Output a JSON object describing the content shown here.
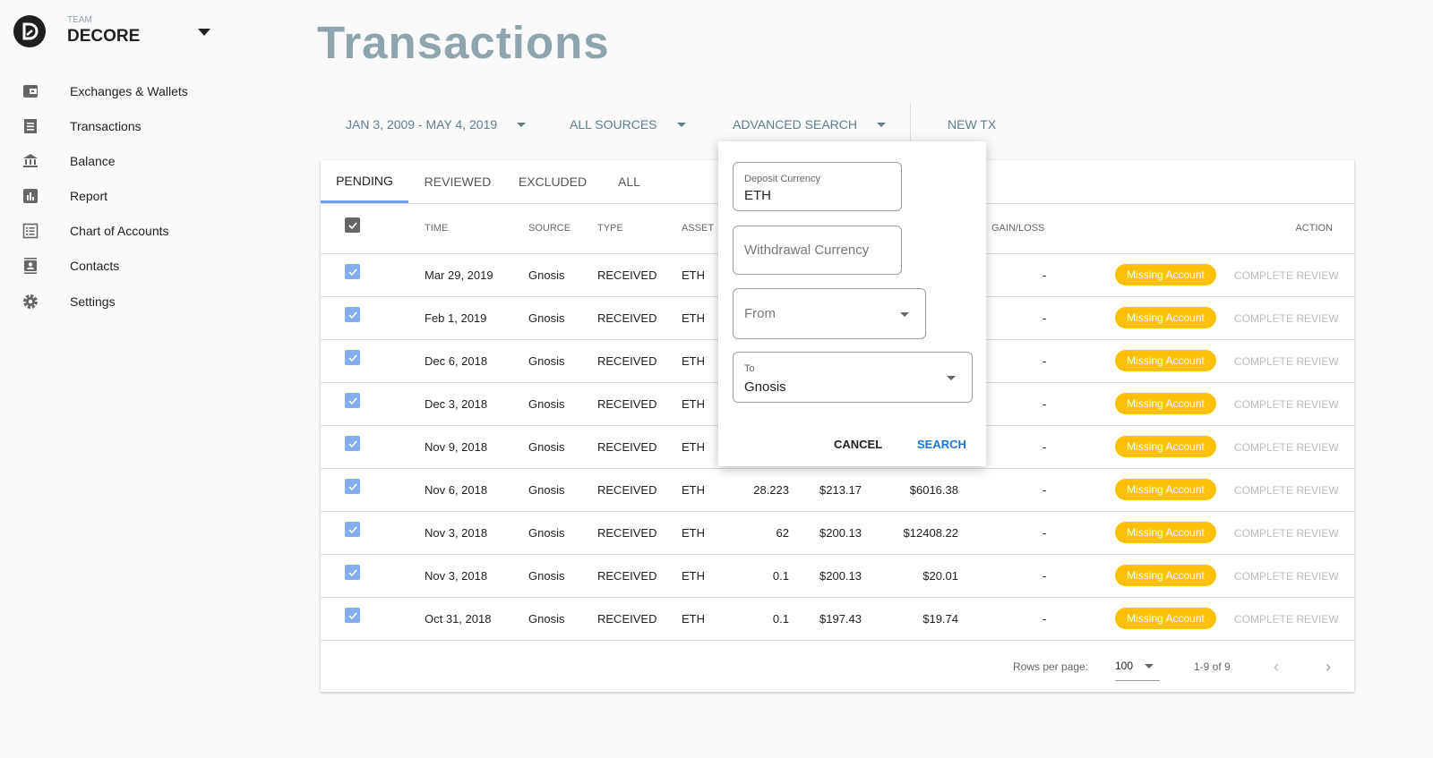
{
  "sidebar": {
    "team_label": "TEAM",
    "team_name": "DECORE",
    "items": [
      {
        "label": "Exchanges & Wallets",
        "icon": "wallet-icon"
      },
      {
        "label": "Transactions",
        "icon": "receipt-icon"
      },
      {
        "label": "Balance",
        "icon": "bank-icon"
      },
      {
        "label": "Report",
        "icon": "bar-chart-icon"
      },
      {
        "label": "Chart of Accounts",
        "icon": "list-icon"
      },
      {
        "label": "Contacts",
        "icon": "contacts-icon"
      },
      {
        "label": "Settings",
        "icon": "gear-icon"
      }
    ]
  },
  "page": {
    "title": "Transactions"
  },
  "toolbar": {
    "date_range": "JAN 3, 2009 - MAY 4, 2019",
    "sources": "ALL SOURCES",
    "advanced_search": "ADVANCED SEARCH",
    "new_tx": "NEW TX"
  },
  "tabs": [
    {
      "label": "PENDING",
      "active": true
    },
    {
      "label": "REVIEWED"
    },
    {
      "label": "EXCLUDED"
    },
    {
      "label": "ALL"
    }
  ],
  "table": {
    "headers": {
      "time": "TIME",
      "source": "SOURCE",
      "type": "TYPE",
      "asset": "ASSET",
      "gain_loss": "GAIN/LOSS",
      "action": "ACTION"
    },
    "rows": [
      {
        "time": "Mar 29, 2019",
        "source": "Gnosis",
        "type": "RECEIVED",
        "asset": "ETH",
        "amount": "",
        "price": "",
        "value": "",
        "gain_loss": "-",
        "status": "Missing Account",
        "action": "COMPLETE REVIEW"
      },
      {
        "time": "Feb 1, 2019",
        "source": "Gnosis",
        "type": "RECEIVED",
        "asset": "ETH",
        "amount": "",
        "price": "",
        "value": "",
        "gain_loss": "-",
        "status": "Missing Account",
        "action": "COMPLETE REVIEW"
      },
      {
        "time": "Dec 6, 2018",
        "source": "Gnosis",
        "type": "RECEIVED",
        "asset": "ETH",
        "amount": "",
        "price": "",
        "value": "",
        "gain_loss": "-",
        "status": "Missing Account",
        "action": "COMPLETE REVIEW"
      },
      {
        "time": "Dec 3, 2018",
        "source": "Gnosis",
        "type": "RECEIVED",
        "asset": "ETH",
        "amount": "",
        "price": "",
        "value": "",
        "gain_loss": "-",
        "status": "Missing Account",
        "action": "COMPLETE REVIEW"
      },
      {
        "time": "Nov 9, 2018",
        "source": "Gnosis",
        "type": "RECEIVED",
        "asset": "ETH",
        "amount": "",
        "price": "",
        "value": "",
        "gain_loss": "-",
        "status": "Missing Account",
        "action": "COMPLETE REVIEW"
      },
      {
        "time": "Nov 6, 2018",
        "source": "Gnosis",
        "type": "RECEIVED",
        "asset": "ETH",
        "amount": "28.223",
        "price": "$213.17",
        "value": "$6016.38",
        "gain_loss": "-",
        "status": "Missing Account",
        "action": "COMPLETE REVIEW"
      },
      {
        "time": "Nov 3, 2018",
        "source": "Gnosis",
        "type": "RECEIVED",
        "asset": "ETH",
        "amount": "62",
        "price": "$200.13",
        "value": "$12408.22",
        "gain_loss": "-",
        "status": "Missing Account",
        "action": "COMPLETE REVIEW"
      },
      {
        "time": "Nov 3, 2018",
        "source": "Gnosis",
        "type": "RECEIVED",
        "asset": "ETH",
        "amount": "0.1",
        "price": "$200.13",
        "value": "$20.01",
        "gain_loss": "-",
        "status": "Missing Account",
        "action": "COMPLETE REVIEW"
      },
      {
        "time": "Oct 31, 2018",
        "source": "Gnosis",
        "type": "RECEIVED",
        "asset": "ETH",
        "amount": "0.1",
        "price": "$197.43",
        "value": "$19.74",
        "gain_loss": "-",
        "status": "Missing Account",
        "action": "COMPLETE REVIEW"
      }
    ],
    "footer": {
      "rows_per_page_label": "Rows per page:",
      "rows_per_page": "100",
      "range": "1-9 of 9"
    }
  },
  "advanced_search": {
    "deposit_label": "Deposit Currency",
    "deposit_value": "ETH",
    "withdrawal_placeholder": "Withdrawal Currency",
    "from_placeholder": "From",
    "to_label": "To",
    "to_value": "Gnosis",
    "cancel": "CANCEL",
    "search": "SEARCH"
  },
  "colors": {
    "accent": "#1976d2",
    "badge": "#ffc107",
    "title": "#90a4ae",
    "toolbar": "#607d8b",
    "checkbox": "#82aef0"
  }
}
